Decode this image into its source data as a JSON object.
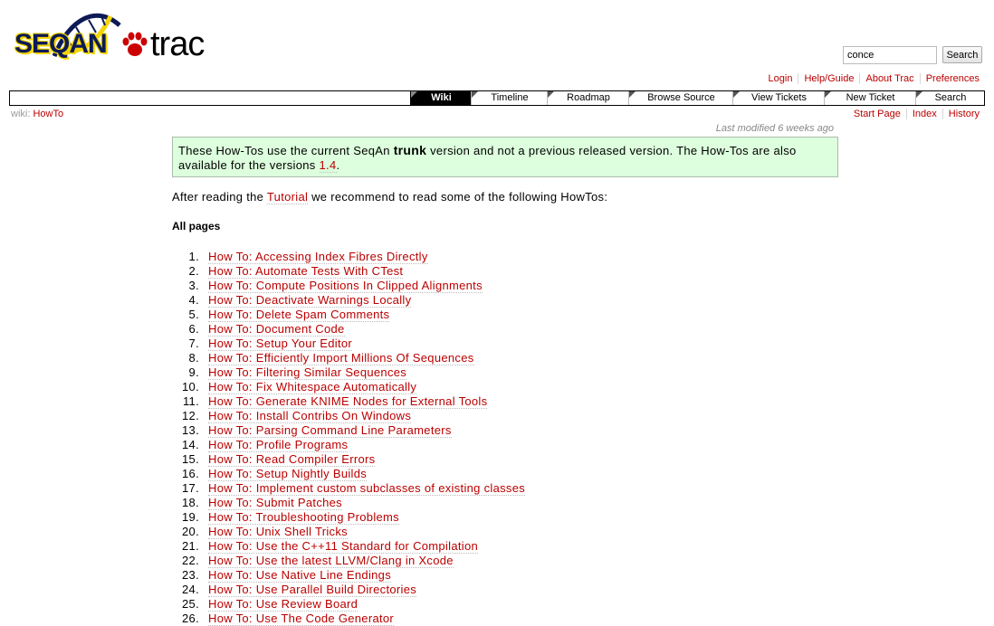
{
  "brand": {
    "logo_text": "SEQAN",
    "trac_text": "trac"
  },
  "search": {
    "value": "conce",
    "button_label": "Search"
  },
  "metanav": [
    "Login",
    "Help/Guide",
    "About Trac",
    "Preferences"
  ],
  "mainnav": [
    "Wiki",
    "Timeline",
    "Roadmap",
    "Browse Source",
    "View Tickets",
    "New Ticket",
    "Search"
  ],
  "breadcrumb": {
    "prefix": "wiki:",
    "page": "HowTo"
  },
  "ctxtnav": [
    "Start Page",
    "Index",
    "History"
  ],
  "last_modified": "Last modified 6 weeks ago",
  "notice": {
    "part1": "These How-Tos use the current SeqAn ",
    "strong": "trunk",
    "part2": " version and not a previous released version. The How-Tos are also available for the versions ",
    "link": "1.4",
    "part3": "."
  },
  "intro": {
    "before": "After reading the ",
    "link": "Tutorial",
    "after": " we recommend to read some of the following HowTos:"
  },
  "heading": "All pages",
  "howtos": [
    {
      "num": "1.",
      "label": "How To: Accessing Index Fibres Directly"
    },
    {
      "num": "2.",
      "label": "How To: Automate Tests With CTest"
    },
    {
      "num": "3.",
      "label": "How To: Compute Positions In Clipped Alignments"
    },
    {
      "num": "4.",
      "label": "How To: Deactivate Warnings Locally"
    },
    {
      "num": "5.",
      "label": "How To: Delete Spam Comments"
    },
    {
      "num": "6.",
      "label": "How To: Document Code"
    },
    {
      "num": "7.",
      "label": "How To: Setup Your Editor"
    },
    {
      "num": "8.",
      "label": "How To: Efficiently Import Millions Of Sequences"
    },
    {
      "num": "9.",
      "label": "How To: Filtering Similar Sequences"
    },
    {
      "num": "10.",
      "label": "How To: Fix Whitespace Automatically"
    },
    {
      "num": "11.",
      "label": "How To: Generate KNIME Nodes for External Tools"
    },
    {
      "num": "12.",
      "label": "How To: Install Contribs On Windows"
    },
    {
      "num": "13.",
      "label": "How To: Parsing Command Line Parameters"
    },
    {
      "num": "14.",
      "label": "How To: Profile Programs"
    },
    {
      "num": "15.",
      "label": "How To: Read Compiler Errors"
    },
    {
      "num": "16.",
      "label": "How To: Setup Nightly Builds"
    },
    {
      "num": "17.",
      "label": "How To: Implement custom subclasses of existing classes"
    },
    {
      "num": "18.",
      "label": "How To: Submit Patches"
    },
    {
      "num": "19.",
      "label": "How To: Troubleshooting Problems"
    },
    {
      "num": "20.",
      "label": "How To: Unix Shell Tricks"
    },
    {
      "num": "21.",
      "label": "How To: Use the C++11 Standard for Compilation"
    },
    {
      "num": "22.",
      "label": "How To: Use the latest LLVM/Clang in Xcode"
    },
    {
      "num": "23.",
      "label": "How To: Use Native Line Endings"
    },
    {
      "num": "24.",
      "label": "How To: Use Parallel Build Directories"
    },
    {
      "num": "25.",
      "label": "How To: Use Review Board"
    },
    {
      "num": "26.",
      "label": "How To: Use The Code Generator"
    }
  ]
}
